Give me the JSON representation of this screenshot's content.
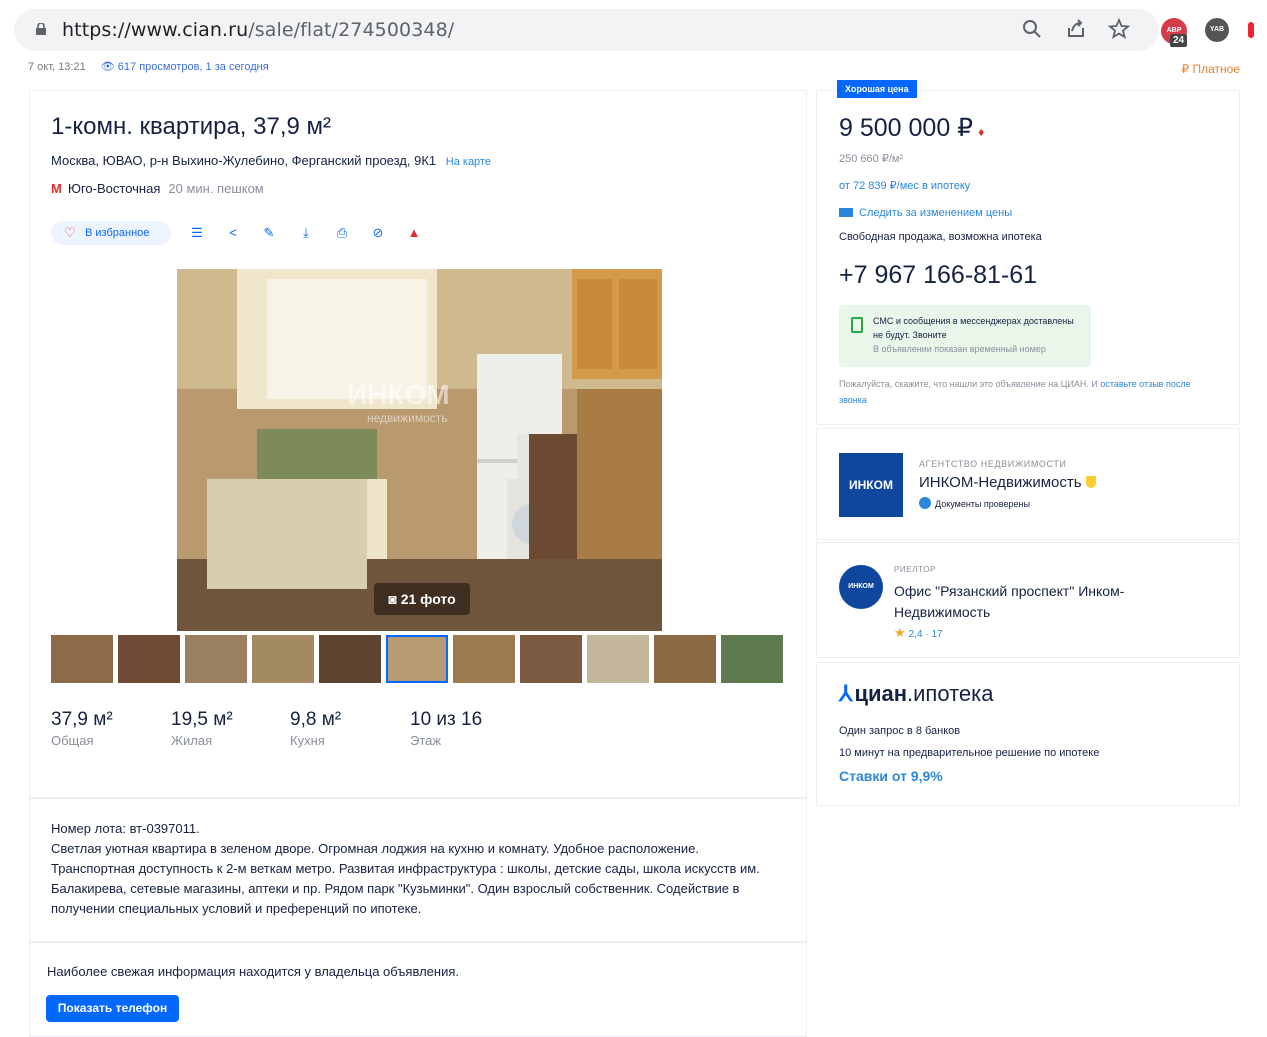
{
  "browser": {
    "url_host": "https://www.cian.ru",
    "url_path": "/sale/flat/274500348/",
    "ext_badge": "24",
    "ext_red_label": "ABP",
    "ext_dark_label": "YAB"
  },
  "meta": {
    "date": "7 окт, 13:21",
    "views": "617 просмотров, 1 за сегодня",
    "paid": "₽ Платное"
  },
  "listing": {
    "title": "1-комн. квартира, 37,9 м²",
    "address": "Москва, ЮВАО, р-н Выхино-Жулебино, Ферганский проезд, 9К1",
    "map_link": "На карте",
    "metro": "Юго-Восточная",
    "walk": "20 мин. пешком",
    "fav_label": "В избранное",
    "photo_count": "21 фото",
    "watermark": "ИНКОМ",
    "watermark_sub": "недвижимость"
  },
  "stats": [
    {
      "value": "37,9 м²",
      "label": "Общая"
    },
    {
      "value": "19,5 м²",
      "label": "Жилая"
    },
    {
      "value": "9,8 м²",
      "label": "Кухня"
    },
    {
      "value": "10 из 16",
      "label": "Этаж"
    }
  ],
  "description": {
    "lot": "Номер лота: вт-0397011.",
    "text": "Светлая уютная квартира в зеленом дворе. Огромная лоджия на кухню и комнату. Удобное расположение. Транспортная доступность к 2-м веткам метро. Развитая инфраструктура : школы, детские сады, школа искусств им. Балакирева, сетевые магазины, аптеки и пр. Рядом парк \"Кузьминки\". Один взрослый собственник. Содействие в получении специальных условий и преференций по ипотеке."
  },
  "contact": {
    "fresh": "Наиболее свежая информация находится у владельца объявления.",
    "show_phone": "Показать телефон"
  },
  "price_card": {
    "badge": "Хорошая цена",
    "price": "9 500 000 ₽",
    "price_per_m": "250 660 ₽/м²",
    "mortgage": "от 72 839 ₽/мес в ипотеку",
    "follow": "Следить за изменением цены",
    "sale_type": "Свободная продажа, возможна ипотека",
    "phone": "+7 967 166-81-61",
    "sms_text": "СМС и сообщения в мессенджерах доставлены не будут. Звоните",
    "sms_note": "В объявлении показан временный номер",
    "note_text": "Пожалуйста, скажите, что нашли это объявление на ЦИАН. И ",
    "note_link": "оставьте отзыв после звонка"
  },
  "agency": {
    "logo": "ИНКОМ",
    "label": "АГЕНТСТВО НЕДВИЖИМОСТИ",
    "name": "ИНКОМ-Недвижимость",
    "docs": "Документы проверены"
  },
  "realtor": {
    "avatar": "ИНКОМ",
    "label": "РИЕЛТОР",
    "name": "Офис \"Рязанский проспект\" Инком-Недвижимость",
    "rating": "2,4 · 17"
  },
  "cian_mortgage": {
    "brand": "циан",
    "product": ".ипотека",
    "line1": "Один запрос в 8 банков",
    "line2": "10 минут на предварительное решение по ипотеке",
    "rates": "Ставки от 9,9%"
  },
  "icons": {
    "lock": "lock-icon",
    "zoom": "zoom-icon",
    "share": "share-icon",
    "star": "bookmark-star-icon",
    "list": "compare-icon",
    "share2": "share-icon",
    "pen": "edit-note-icon",
    "download": "download-icon",
    "print": "print-icon",
    "hide": "hide-icon",
    "report": "report-icon"
  },
  "colors": {
    "accent": "#0468ff",
    "link": "#2b87db",
    "text": "#152242",
    "muted": "#8a8f9c",
    "metro_red": "#e12c2c",
    "paid_orange": "#e8832a"
  }
}
